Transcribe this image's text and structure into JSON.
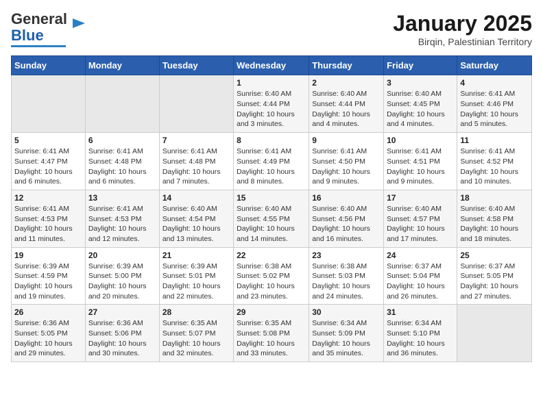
{
  "logo": {
    "general": "General",
    "blue": "Blue"
  },
  "title": "January 2025",
  "subtitle": "Birqin, Palestinian Territory",
  "days_header": [
    "Sunday",
    "Monday",
    "Tuesday",
    "Wednesday",
    "Thursday",
    "Friday",
    "Saturday"
  ],
  "weeks": [
    [
      {
        "day": "",
        "sunrise": "",
        "sunset": "",
        "daylight": ""
      },
      {
        "day": "",
        "sunrise": "",
        "sunset": "",
        "daylight": ""
      },
      {
        "day": "",
        "sunrise": "",
        "sunset": "",
        "daylight": ""
      },
      {
        "day": "1",
        "sunrise": "Sunrise: 6:40 AM",
        "sunset": "Sunset: 4:44 PM",
        "daylight": "Daylight: 10 hours and 3 minutes."
      },
      {
        "day": "2",
        "sunrise": "Sunrise: 6:40 AM",
        "sunset": "Sunset: 4:44 PM",
        "daylight": "Daylight: 10 hours and 4 minutes."
      },
      {
        "day": "3",
        "sunrise": "Sunrise: 6:40 AM",
        "sunset": "Sunset: 4:45 PM",
        "daylight": "Daylight: 10 hours and 4 minutes."
      },
      {
        "day": "4",
        "sunrise": "Sunrise: 6:41 AM",
        "sunset": "Sunset: 4:46 PM",
        "daylight": "Daylight: 10 hours and 5 minutes."
      }
    ],
    [
      {
        "day": "5",
        "sunrise": "Sunrise: 6:41 AM",
        "sunset": "Sunset: 4:47 PM",
        "daylight": "Daylight: 10 hours and 6 minutes."
      },
      {
        "day": "6",
        "sunrise": "Sunrise: 6:41 AM",
        "sunset": "Sunset: 4:48 PM",
        "daylight": "Daylight: 10 hours and 6 minutes."
      },
      {
        "day": "7",
        "sunrise": "Sunrise: 6:41 AM",
        "sunset": "Sunset: 4:48 PM",
        "daylight": "Daylight: 10 hours and 7 minutes."
      },
      {
        "day": "8",
        "sunrise": "Sunrise: 6:41 AM",
        "sunset": "Sunset: 4:49 PM",
        "daylight": "Daylight: 10 hours and 8 minutes."
      },
      {
        "day": "9",
        "sunrise": "Sunrise: 6:41 AM",
        "sunset": "Sunset: 4:50 PM",
        "daylight": "Daylight: 10 hours and 9 minutes."
      },
      {
        "day": "10",
        "sunrise": "Sunrise: 6:41 AM",
        "sunset": "Sunset: 4:51 PM",
        "daylight": "Daylight: 10 hours and 9 minutes."
      },
      {
        "day": "11",
        "sunrise": "Sunrise: 6:41 AM",
        "sunset": "Sunset: 4:52 PM",
        "daylight": "Daylight: 10 hours and 10 minutes."
      }
    ],
    [
      {
        "day": "12",
        "sunrise": "Sunrise: 6:41 AM",
        "sunset": "Sunset: 4:53 PM",
        "daylight": "Daylight: 10 hours and 11 minutes."
      },
      {
        "day": "13",
        "sunrise": "Sunrise: 6:41 AM",
        "sunset": "Sunset: 4:53 PM",
        "daylight": "Daylight: 10 hours and 12 minutes."
      },
      {
        "day": "14",
        "sunrise": "Sunrise: 6:40 AM",
        "sunset": "Sunset: 4:54 PM",
        "daylight": "Daylight: 10 hours and 13 minutes."
      },
      {
        "day": "15",
        "sunrise": "Sunrise: 6:40 AM",
        "sunset": "Sunset: 4:55 PM",
        "daylight": "Daylight: 10 hours and 14 minutes."
      },
      {
        "day": "16",
        "sunrise": "Sunrise: 6:40 AM",
        "sunset": "Sunset: 4:56 PM",
        "daylight": "Daylight: 10 hours and 16 minutes."
      },
      {
        "day": "17",
        "sunrise": "Sunrise: 6:40 AM",
        "sunset": "Sunset: 4:57 PM",
        "daylight": "Daylight: 10 hours and 17 minutes."
      },
      {
        "day": "18",
        "sunrise": "Sunrise: 6:40 AM",
        "sunset": "Sunset: 4:58 PM",
        "daylight": "Daylight: 10 hours and 18 minutes."
      }
    ],
    [
      {
        "day": "19",
        "sunrise": "Sunrise: 6:39 AM",
        "sunset": "Sunset: 4:59 PM",
        "daylight": "Daylight: 10 hours and 19 minutes."
      },
      {
        "day": "20",
        "sunrise": "Sunrise: 6:39 AM",
        "sunset": "Sunset: 5:00 PM",
        "daylight": "Daylight: 10 hours and 20 minutes."
      },
      {
        "day": "21",
        "sunrise": "Sunrise: 6:39 AM",
        "sunset": "Sunset: 5:01 PM",
        "daylight": "Daylight: 10 hours and 22 minutes."
      },
      {
        "day": "22",
        "sunrise": "Sunrise: 6:38 AM",
        "sunset": "Sunset: 5:02 PM",
        "daylight": "Daylight: 10 hours and 23 minutes."
      },
      {
        "day": "23",
        "sunrise": "Sunrise: 6:38 AM",
        "sunset": "Sunset: 5:03 PM",
        "daylight": "Daylight: 10 hours and 24 minutes."
      },
      {
        "day": "24",
        "sunrise": "Sunrise: 6:37 AM",
        "sunset": "Sunset: 5:04 PM",
        "daylight": "Daylight: 10 hours and 26 minutes."
      },
      {
        "day": "25",
        "sunrise": "Sunrise: 6:37 AM",
        "sunset": "Sunset: 5:05 PM",
        "daylight": "Daylight: 10 hours and 27 minutes."
      }
    ],
    [
      {
        "day": "26",
        "sunrise": "Sunrise: 6:36 AM",
        "sunset": "Sunset: 5:05 PM",
        "daylight": "Daylight: 10 hours and 29 minutes."
      },
      {
        "day": "27",
        "sunrise": "Sunrise: 6:36 AM",
        "sunset": "Sunset: 5:06 PM",
        "daylight": "Daylight: 10 hours and 30 minutes."
      },
      {
        "day": "28",
        "sunrise": "Sunrise: 6:35 AM",
        "sunset": "Sunset: 5:07 PM",
        "daylight": "Daylight: 10 hours and 32 minutes."
      },
      {
        "day": "29",
        "sunrise": "Sunrise: 6:35 AM",
        "sunset": "Sunset: 5:08 PM",
        "daylight": "Daylight: 10 hours and 33 minutes."
      },
      {
        "day": "30",
        "sunrise": "Sunrise: 6:34 AM",
        "sunset": "Sunset: 5:09 PM",
        "daylight": "Daylight: 10 hours and 35 minutes."
      },
      {
        "day": "31",
        "sunrise": "Sunrise: 6:34 AM",
        "sunset": "Sunset: 5:10 PM",
        "daylight": "Daylight: 10 hours and 36 minutes."
      },
      {
        "day": "",
        "sunrise": "",
        "sunset": "",
        "daylight": ""
      }
    ]
  ]
}
